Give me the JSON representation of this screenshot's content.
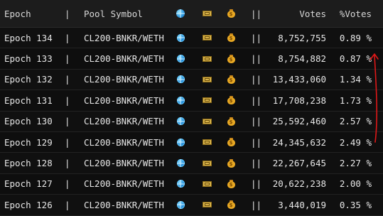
{
  "header": {
    "epoch": "Epoch",
    "sep": "|",
    "pool_symbol": "Pool Symbol",
    "globe_icon": "globe-icon",
    "ticket_icon": "ticket-icon",
    "bag_icon": "money-bag-icon",
    "pipes": "||",
    "votes": "Votes",
    "pct_votes": "%Votes"
  },
  "rows": [
    {
      "epoch": "Epoch 134",
      "sep": "|",
      "pool": "CL200-BNKR/WETH",
      "pipes": "||",
      "votes": "8,752,755",
      "pct": "0.89 %"
    },
    {
      "epoch": "Epoch 133",
      "sep": "|",
      "pool": "CL200-BNKR/WETH",
      "pipes": "||",
      "votes": "8,754,882",
      "pct": "0.87 %"
    },
    {
      "epoch": "Epoch 132",
      "sep": "|",
      "pool": "CL200-BNKR/WETH",
      "pipes": "||",
      "votes": "13,433,060",
      "pct": "1.34 %"
    },
    {
      "epoch": "Epoch 131",
      "sep": "|",
      "pool": "CL200-BNKR/WETH",
      "pipes": "||",
      "votes": "17,708,238",
      "pct": "1.73 %"
    },
    {
      "epoch": "Epoch 130",
      "sep": "|",
      "pool": "CL200-BNKR/WETH",
      "pipes": "||",
      "votes": "25,592,460",
      "pct": "2.57 %"
    },
    {
      "epoch": "Epoch 129",
      "sep": "|",
      "pool": "CL200-BNKR/WETH",
      "pipes": "||",
      "votes": "24,345,632",
      "pct": "2.49 %"
    },
    {
      "epoch": "Epoch 128",
      "sep": "|",
      "pool": "CL200-BNKR/WETH",
      "pipes": "||",
      "votes": "22,267,645",
      "pct": "2.27 %"
    },
    {
      "epoch": "Epoch 127",
      "sep": "|",
      "pool": "CL200-BNKR/WETH",
      "pipes": "||",
      "votes": "20,622,238",
      "pct": "2.00 %"
    },
    {
      "epoch": "Epoch 126",
      "sep": "|",
      "pool": "CL200-BNKR/WETH",
      "pipes": "||",
      "votes": "3,440,019",
      "pct": "0.35 %"
    }
  ],
  "colors": {
    "background": "#0d0d0d",
    "header_bg": "#1c1c1c",
    "text": "#e6e6e6",
    "annotation": "#e01818"
  }
}
